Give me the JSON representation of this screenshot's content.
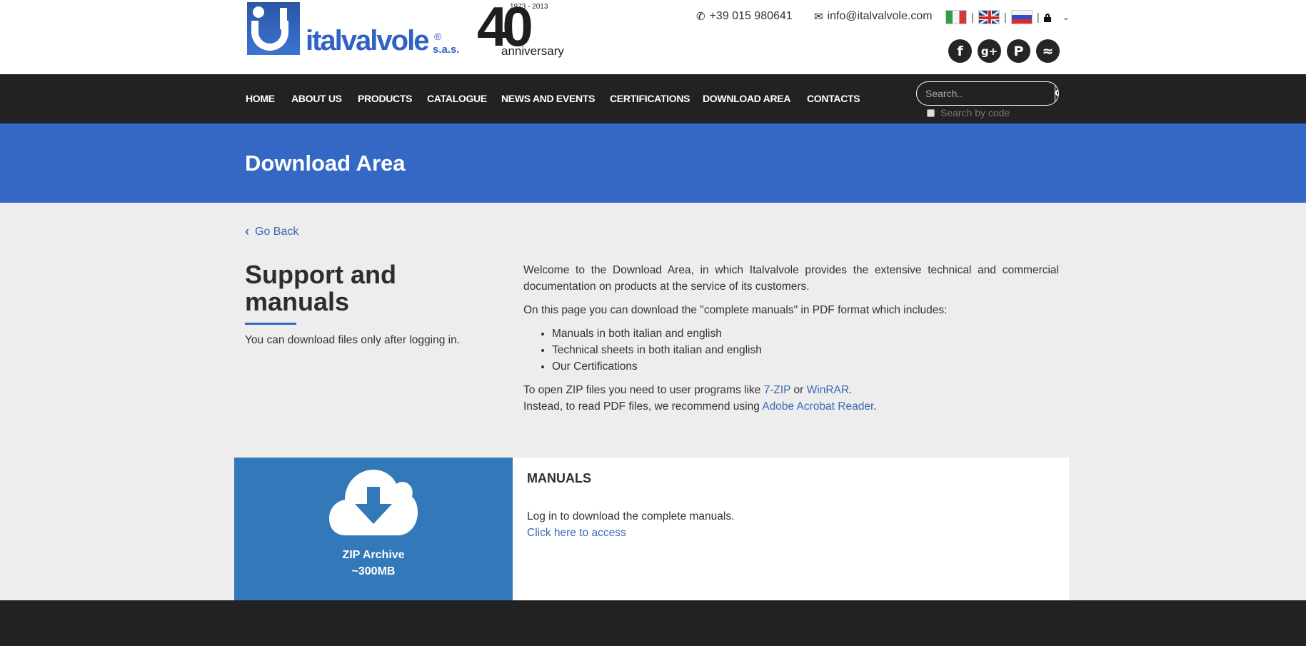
{
  "brand": {
    "name": "italvalvole",
    "registered": "®",
    "suffix": "s.a.s.",
    "anniversary_years": "1973 - 2013",
    "anniversary_number": "40",
    "anniversary_word": "anniversary"
  },
  "header": {
    "phone": "+39 015 980641",
    "email": "info@italvalvole.com",
    "languages": [
      {
        "code": "it",
        "icon": "italy-flag-icon"
      },
      {
        "code": "en",
        "icon": "uk-flag-icon"
      },
      {
        "code": "ru",
        "icon": "russia-flag-icon"
      }
    ],
    "separator": "|",
    "login_icon": "lock-icon",
    "dropdown_glyph": "⌄",
    "socials": [
      {
        "name": "facebook",
        "glyph": "f"
      },
      {
        "name": "google-plus",
        "glyph": "g+"
      },
      {
        "name": "pinterest",
        "glyph": "P"
      },
      {
        "name": "rss",
        "glyph": "≈"
      }
    ]
  },
  "nav": {
    "items": [
      "HOME",
      "ABOUT US",
      "PRODUCTS",
      "CATALOGUE",
      "NEWS AND EVENTS",
      "CERTIFICATIONS",
      "DOWNLOAD AREA",
      "CONTACTS"
    ],
    "search_placeholder": "Search..",
    "search_by_code_label": "Search by code",
    "search_by_code_checked": false
  },
  "banner": {
    "title": "Download Area"
  },
  "page": {
    "go_back": "Go Back",
    "left": {
      "heading": "Support and manuals",
      "note": "You can download files only after logging in."
    },
    "right": {
      "intro": "Welcome to the Download Area, in which Italvalvole provides the extensive technical and commercial documentation on products at the service of its customers.",
      "includes": "On this page you can download the \"complete manuals\" in PDF format which includes:",
      "list": [
        "Manuals in both italian and english",
        "Technical sheets in both italian and english",
        "Our Certifications"
      ],
      "zip_prefix": "To open ZIP files you need to user programs like ",
      "zip_link1": "7-ZIP",
      "zip_or": " or ",
      "zip_link2": "WinRAR",
      "zip_end": ".",
      "pdf_prefix": "Instead, to read PDF files, we recommend using ",
      "pdf_link": "Adobe Acrobat Reader",
      "pdf_end": "."
    },
    "download": {
      "file_type": "ZIP Archive",
      "file_size": "~300MB",
      "section_title": "MANUALS",
      "message": "Log in to download the complete manuals.",
      "access_link": "Click here to access"
    }
  },
  "colors": {
    "accent_blue": "#3568c4",
    "panel_blue": "#3378b8",
    "link_blue": "#3a6ab3",
    "dark": "#222222",
    "background": "#ededed"
  }
}
